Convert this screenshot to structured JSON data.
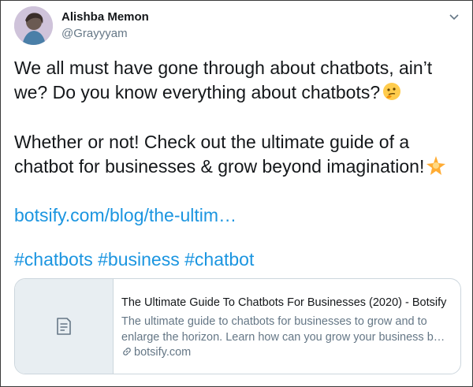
{
  "author": {
    "name": "Alishba Memon",
    "handle": "@Grayyyam"
  },
  "menu_icon": "chevron-down-icon",
  "body": {
    "line1": "We all must have gone through about chatbots, ain’t",
    "line2": "we? Do you know everything about chatbots?",
    "line2_emoji": "thinking-face-icon",
    "line3": "Whether or not! Check out the ultimate guide of a",
    "line4": "chatbot for businesses & grow beyond imagination!",
    "line4_emoji": "glowing-star-icon",
    "link": "botsify.com/blog/the-ultim…",
    "hashtags": [
      "#chatbots",
      "#business",
      "#chatbot"
    ]
  },
  "card": {
    "thumb_icon": "document-icon",
    "title": "The Ultimate Guide To Chatbots For Businesses (2020) - Botsify",
    "desc_line1": "The ultimate guide to chatbots for businesses to grow and to",
    "desc_line2": "enlarge the horizon. Learn how can you grow your business b…",
    "domain": "botsify.com",
    "domain_icon": "link-icon"
  },
  "colors": {
    "link": "#1b95e0",
    "text": "#14171a",
    "muted": "#657786"
  }
}
